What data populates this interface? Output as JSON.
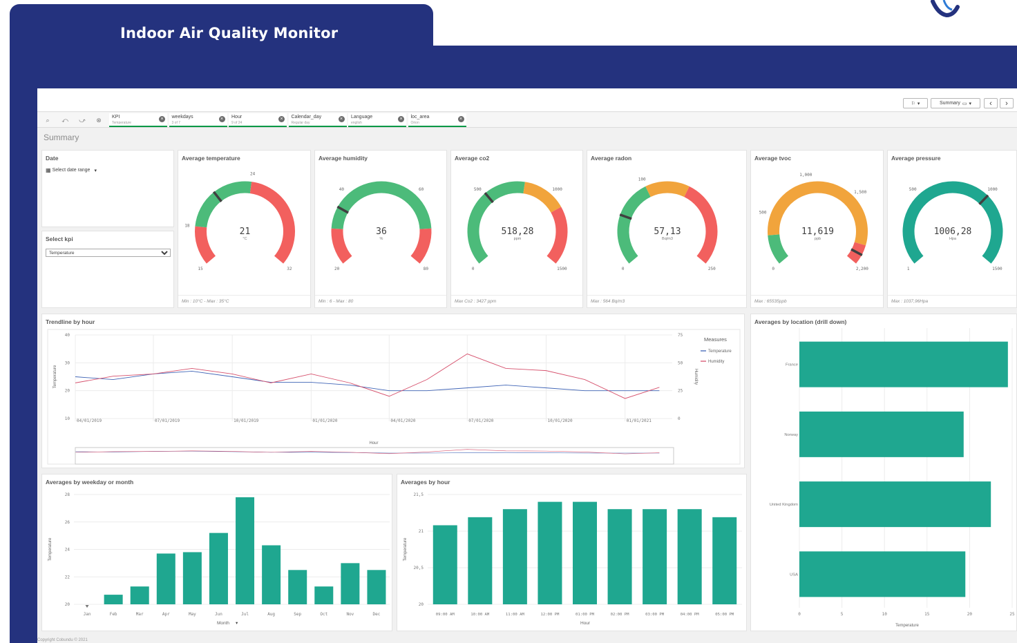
{
  "app": {
    "title": "Indoor Air Quality Monitor",
    "sheet_title": "Summary",
    "copyright": "Copyright Cobundu © 2021"
  },
  "colors": {
    "navy": "#24327e",
    "teal": "#1fa790",
    "green": "#4cbb7a",
    "red": "#f2605e",
    "orange": "#f1a43c",
    "humidity": "#d6506c",
    "temperature": "#3f64b6"
  },
  "toolbar": {
    "bookmark_icon": "bookmark-icon",
    "sheet_label": "Summary",
    "prev": "‹",
    "next": "›"
  },
  "selections": [
    {
      "title": "KPI",
      "value": "Temperature"
    },
    {
      "title": "weekdays",
      "value": "3 of 7"
    },
    {
      "title": "Hour",
      "value": "9 of 24"
    },
    {
      "title": "Calendar_day",
      "value": "Regular day"
    },
    {
      "title": "Language",
      "value": "english"
    },
    {
      "title": "loc_area",
      "value": "Orion"
    }
  ],
  "date_panel": {
    "title": "Date",
    "picker_label": "Select date range"
  },
  "kpi_panel": {
    "title": "Select kpi",
    "selected": "Temperature"
  },
  "gauges": [
    {
      "title": "Average temperature",
      "value_text": "21",
      "unit": "°C",
      "min": 15,
      "max": 32,
      "value": 21,
      "segments": [
        {
          "to": 18,
          "color": "red"
        },
        {
          "to": 24,
          "color": "green"
        },
        {
          "to": 32,
          "color": "red"
        }
      ],
      "labels": [
        {
          "at": 15,
          "text": "15"
        },
        {
          "at": 18,
          "text": "18"
        },
        {
          "at": 24,
          "text": "24"
        },
        {
          "at": 32,
          "text": "32"
        }
      ],
      "footer": "Min : 10°C - Max : 35°C"
    },
    {
      "title": "Average humidity",
      "value_text": "36",
      "unit": "%",
      "min": 20,
      "max": 80,
      "value": 36,
      "segments": [
        {
          "to": 30,
          "color": "red"
        },
        {
          "to": 70,
          "color": "green"
        },
        {
          "to": 80,
          "color": "red"
        }
      ],
      "labels": [
        {
          "at": 20,
          "text": "20"
        },
        {
          "at": 40,
          "text": "40"
        },
        {
          "at": 60,
          "text": "60"
        },
        {
          "at": 80,
          "text": "80"
        }
      ],
      "footer": "Min : 6 - Max : 80"
    },
    {
      "title": "Average co2",
      "value_text": "518,28",
      "unit": "ppm",
      "min": 0,
      "max": 1500,
      "value": 518.28,
      "segments": [
        {
          "to": 800,
          "color": "green"
        },
        {
          "to": 1100,
          "color": "orange"
        },
        {
          "to": 1500,
          "color": "red"
        }
      ],
      "labels": [
        {
          "at": 0,
          "text": "0"
        },
        {
          "at": 500,
          "text": "500"
        },
        {
          "at": 1000,
          "text": "1000"
        },
        {
          "at": 1500,
          "text": "1500"
        }
      ],
      "footer": "Max Co2 : 3427 ppm"
    },
    {
      "title": "Average radon",
      "value_text": "57,13",
      "unit": "Bq/m3",
      "min": 0,
      "max": 250,
      "value": 57.13,
      "segments": [
        {
          "to": 100,
          "color": "green"
        },
        {
          "to": 150,
          "color": "orange"
        },
        {
          "to": 250,
          "color": "red"
        }
      ],
      "labels": [
        {
          "at": 0,
          "text": "0"
        },
        {
          "at": 100,
          "text": "100"
        },
        {
          "at": 250,
          "text": "250"
        }
      ],
      "footer": "Max : 564 Bq/m3"
    },
    {
      "title": "Average tvoc",
      "value_text": "11,619",
      "unit": "ppb",
      "min": 0,
      "max": 2200,
      "value": 2100,
      "segments": [
        {
          "to": 300,
          "color": "green"
        },
        {
          "to": 2000,
          "color": "orange"
        },
        {
          "to": 2200,
          "color": "red"
        }
      ],
      "labels": [
        {
          "at": 0,
          "text": "0"
        },
        {
          "at": 500,
          "text": "500"
        },
        {
          "at": 1000,
          "text": "1,000"
        },
        {
          "at": 1500,
          "text": "1,500"
        },
        {
          "at": 2200,
          "text": "2,200"
        }
      ],
      "footer": "Max : 65535ppb"
    },
    {
      "title": "Average pressure",
      "value_text": "1006,28",
      "unit": "Hpa",
      "min": 1,
      "max": 1500,
      "value": 1006.28,
      "segments": [
        {
          "to": 1500,
          "color": "teal"
        }
      ],
      "labels": [
        {
          "at": 1,
          "text": "1"
        },
        {
          "at": 500,
          "text": "500"
        },
        {
          "at": 1000,
          "text": "1000"
        },
        {
          "at": 1500,
          "text": "1500"
        }
      ],
      "footer": "Max : 1037,96Hpa"
    }
  ],
  "chart_data": [
    {
      "type": "line",
      "title": "Trendline by hour",
      "xlabel": "Hour",
      "ylabel": "Temperature",
      "y2label": "Humidity",
      "ylim": [
        10,
        40
      ],
      "y2lim": [
        0,
        75
      ],
      "x_ticks": [
        "04/01/2019",
        "07/01/2019",
        "10/01/2019",
        "01/01/2020",
        "04/01/2020",
        "07/01/2020",
        "10/01/2020",
        "01/01/2021"
      ],
      "y_ticks": [
        10,
        20,
        30,
        40
      ],
      "y2_ticks": [
        0,
        25,
        50,
        75
      ],
      "legend": {
        "title": "Measures",
        "items": [
          "Temperature",
          "Humidity"
        ]
      },
      "series": [
        {
          "name": "Temperature",
          "color": "#3f64b6",
          "x": [
            "04/01/2019",
            "05/15/2019",
            "07/01/2019",
            "08/15/2019",
            "10/01/2019",
            "11/15/2019",
            "01/01/2020",
            "02/15/2020",
            "04/01/2020",
            "05/15/2020",
            "07/01/2020",
            "08/15/2020",
            "10/01/2020",
            "11/15/2020",
            "01/01/2021",
            "02/10/2021"
          ],
          "values": [
            25,
            24,
            26,
            27,
            25,
            23,
            23,
            22,
            20,
            20,
            21,
            22,
            21,
            20,
            20,
            20
          ]
        },
        {
          "name": "Humidity",
          "color": "#d6506c",
          "x": [
            "04/01/2019",
            "05/15/2019",
            "07/01/2019",
            "08/15/2019",
            "10/01/2019",
            "11/15/2019",
            "01/01/2020",
            "02/15/2020",
            "04/01/2020",
            "05/15/2020",
            "07/01/2020",
            "08/15/2020",
            "10/01/2020",
            "11/15/2020",
            "01/01/2021",
            "02/10/2021"
          ],
          "values": [
            32,
            38,
            40,
            45,
            40,
            32,
            40,
            32,
            20,
            35,
            58,
            45,
            43,
            35,
            18,
            28
          ]
        }
      ]
    },
    {
      "type": "bar",
      "title": "Averages by weekday or month",
      "xlabel": "Month",
      "ylabel": "Temperature",
      "ylim": [
        20,
        28
      ],
      "y_ticks": [
        20,
        22,
        24,
        26,
        28
      ],
      "categories": [
        "Jan",
        "Feb",
        "Mar",
        "Apr",
        "May",
        "Jun",
        "Jul",
        "Aug",
        "Sep",
        "Oct",
        "Nov",
        "Dec"
      ],
      "values": [
        19.9,
        20.7,
        21.3,
        23.7,
        23.8,
        25.2,
        27.8,
        24.3,
        22.5,
        21.3,
        23.0,
        22.5
      ]
    },
    {
      "type": "bar",
      "title": "Averages by hour",
      "xlabel": "Hour",
      "ylabel": "Temperature",
      "ylim": [
        20,
        21.5
      ],
      "y_ticks": [
        "20",
        "20,5",
        "21",
        "21,5"
      ],
      "categories": [
        "09:00 AM",
        "10:00 AM",
        "11:00 AM",
        "12:00 PM",
        "01:00 PM",
        "02:00 PM",
        "03:00 PM",
        "04:00 PM",
        "05:00 PM"
      ],
      "values": [
        21.08,
        21.19,
        21.3,
        21.4,
        21.4,
        21.3,
        21.3,
        21.3,
        21.19
      ]
    },
    {
      "type": "bar",
      "orientation": "horizontal",
      "title": "Averages by location (drill down)",
      "xlabel": "Temperature",
      "xlim": [
        0,
        25
      ],
      "x_ticks": [
        0,
        5,
        10,
        15,
        20,
        25
      ],
      "categories": [
        "France",
        "Norway",
        "United Kingdom",
        "USA"
      ],
      "values": [
        24.5,
        19.3,
        22.5,
        19.5
      ]
    }
  ]
}
